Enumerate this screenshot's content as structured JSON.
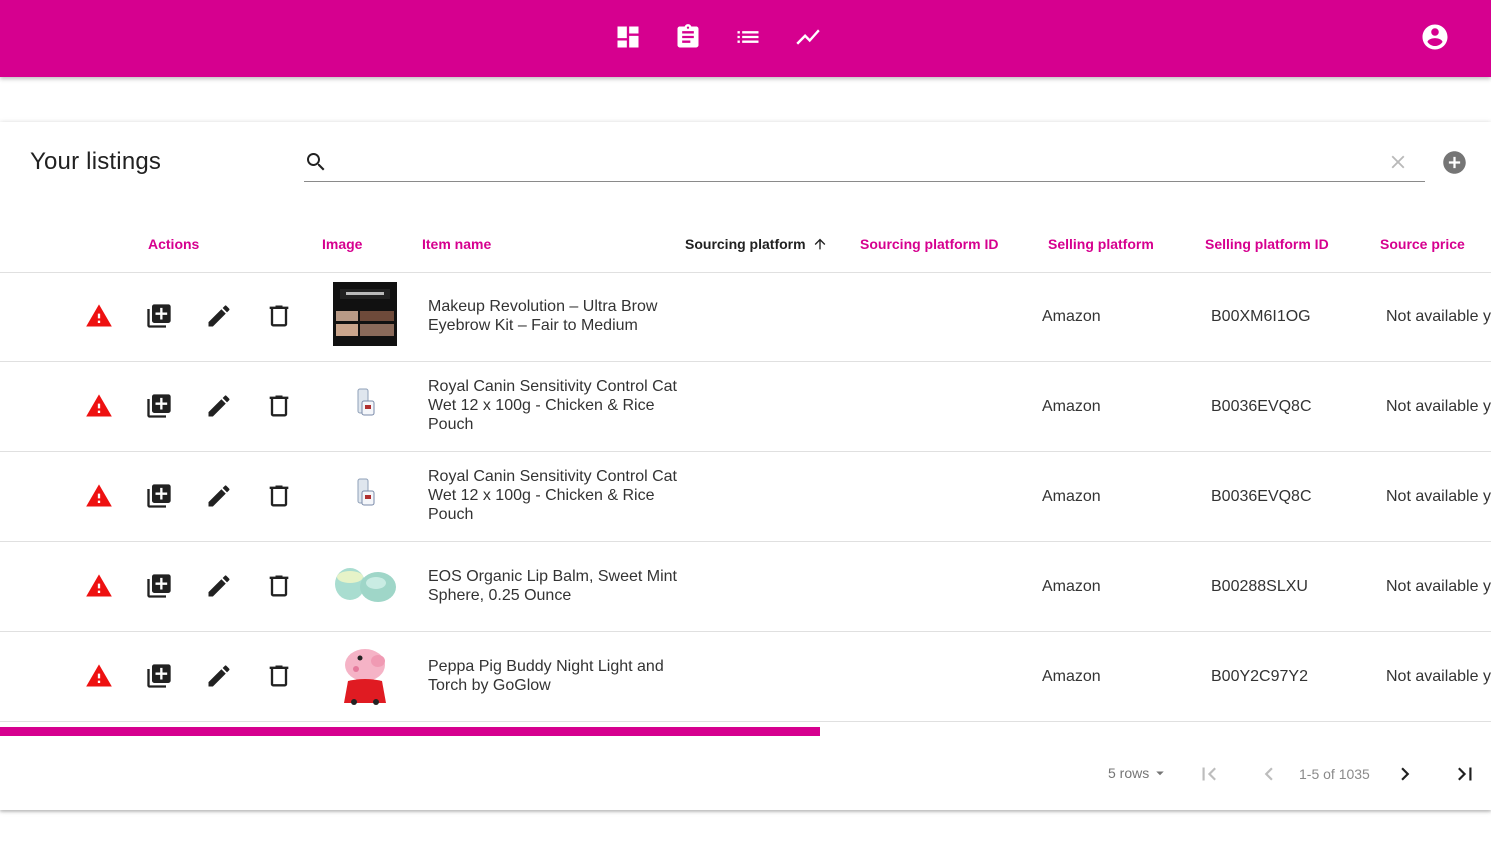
{
  "appbar": {
    "nav_icons": [
      "dashboard-icon",
      "assignment-icon",
      "list-icon",
      "trending-icon"
    ],
    "account_icon": "account-circle-icon",
    "color": "#d6008f"
  },
  "listings": {
    "title": "Your listings",
    "search": {
      "value": "",
      "placeholder": ""
    },
    "columns": {
      "actions": "Actions",
      "image": "Image",
      "item_name": "Item name",
      "sourcing_platform": "Sourcing platform",
      "sourcing_platform_id": "Sourcing platform ID",
      "selling_platform": "Selling platform",
      "selling_platform_id": "Selling platform ID",
      "source_price": "Source price"
    },
    "rows": [
      {
        "item_name": "Makeup Revolution – Ultra Brow Eyebrow Kit – Fair to Medium",
        "sourcing_platform": "",
        "sourcing_platform_id": "",
        "selling_platform": "Amazon",
        "selling_platform_id": "B00XM6I1OG",
        "source_price": "Not available yet",
        "image": "eyebrow-palette"
      },
      {
        "item_name": "Royal Canin Sensitivity Control Cat Wet 12 x 100g - Chicken & Rice Pouch",
        "sourcing_platform": "",
        "sourcing_platform_id": "",
        "selling_platform": "Amazon",
        "selling_platform_id": "B0036EVQ8C",
        "source_price": "Not available yet",
        "image": "pet-food-pouch"
      },
      {
        "item_name": "Royal Canin Sensitivity Control Cat Wet 12 x 100g - Chicken & Rice Pouch",
        "sourcing_platform": "",
        "sourcing_platform_id": "",
        "selling_platform": "Amazon",
        "selling_platform_id": "B0036EVQ8C",
        "source_price": "Not available yet",
        "image": "pet-food-pouch"
      },
      {
        "item_name": "EOS Organic Lip Balm, Sweet Mint Sphere, 0.25 Ounce",
        "sourcing_platform": "",
        "sourcing_platform_id": "",
        "selling_platform": "Amazon",
        "selling_platform_id": "B00288SLXU",
        "source_price": "Not available yet",
        "image": "lip-balm-sphere"
      },
      {
        "item_name": "Peppa Pig Buddy Night Light and Torch by GoGlow",
        "sourcing_platform": "",
        "sourcing_platform_id": "",
        "selling_platform": "Amazon",
        "selling_platform_id": "B00Y2C97Y2",
        "source_price": "Not available yet",
        "image": "peppa-pig-light"
      }
    ],
    "horizontal_scroll_fraction": 0.55,
    "pagination": {
      "rows_per_page": "5 rows",
      "range": "1-5 of 1035"
    }
  }
}
